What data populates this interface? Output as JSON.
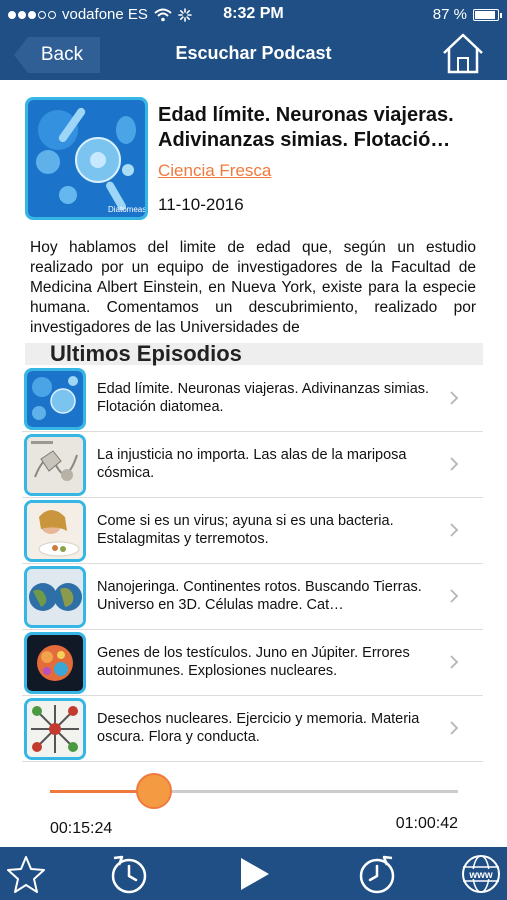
{
  "status_bar": {
    "carrier": "vodafone ES",
    "time": "8:32 PM",
    "battery": "87 %"
  },
  "nav": {
    "back_label": "Back",
    "title": "Escuchar Podcast",
    "home_icon": "home-icon"
  },
  "episode": {
    "title": "Edad límite. Neuronas viajeras. Adivinanzas simias. Flotació…",
    "show": "Ciencia Fresca",
    "date": "11-10-2016",
    "cover_caption": "Diatomeas",
    "description": "Hoy hablamos del limite de edad que, según un estudio realizado por un equipo de investigadores de la Facultad de Medicina Albert Einstein, en Nueva York, existe para la especie humana. Comentamos un descubrimiento, realizado por investigadores de las Universidades de"
  },
  "episodes_section": {
    "title": "Ultimos Episodios",
    "items": [
      {
        "text": "Edad límite. Neuronas viajeras. Adivinanzas simias. Flotación diatomea."
      },
      {
        "text": "La injusticia no importa. Las alas de la mariposa cósmica."
      },
      {
        "text": "Come si es un virus; ayuna si es una bacteria. Estalagmitas y terremotos."
      },
      {
        "text": "Nanojeringa. Continentes rotos. Buscando Tierras. Universo en 3D. Células madre. Cat…"
      },
      {
        "text": "Genes de los testículos. Juno en Júpiter. Errores autoinmunes. Explosiones nucleares."
      },
      {
        "text": "Desechos nucleares. Ejercicio y memoria. Materia oscura. Flora y conducta."
      }
    ]
  },
  "player": {
    "elapsed": "00:15:24",
    "total": "01:00:42",
    "progress": 0.254
  },
  "toolbar": {
    "buttons": [
      "star-icon",
      "rewind-timer-icon",
      "play-icon",
      "forward-timer-icon",
      "globe-www-icon"
    ]
  },
  "colors": {
    "nav_bg": "#1f4f84",
    "accent_orange": "#f07a3d",
    "thumb_border": "#36b6e5"
  }
}
